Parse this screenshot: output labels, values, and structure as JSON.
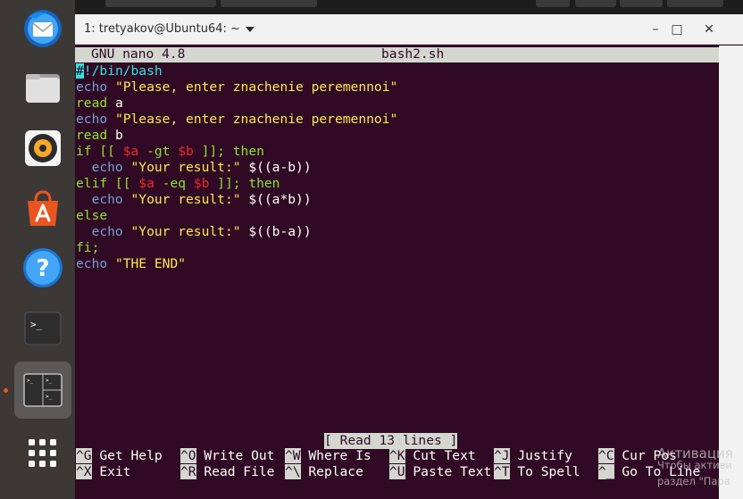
{
  "window": {
    "title": "1: tretyakov@Ubuntu64: ~",
    "minimize_label": "–",
    "maximize_label": "□",
    "close_label": "✕"
  },
  "nano": {
    "version": "GNU nano 4.8",
    "filename": "bash2.sh",
    "status": "[ Read 13 lines ]"
  },
  "code": [
    [
      {
        "t": "#",
        "c": "hash"
      },
      {
        "t": "!/bin/bash",
        "c": "shebang"
      }
    ],
    [
      {
        "t": "echo",
        "c": "kw"
      },
      {
        "t": " ",
        "c": "norm"
      },
      {
        "t": "\"Please, enter znachenie peremennoi\"",
        "c": "str"
      }
    ],
    [
      {
        "t": "read",
        "c": "ctl"
      },
      {
        "t": " a",
        "c": "norm"
      }
    ],
    [
      {
        "t": "echo",
        "c": "kw"
      },
      {
        "t": " ",
        "c": "norm"
      },
      {
        "t": "\"Please, enter znachenie peremennoi\"",
        "c": "str"
      }
    ],
    [
      {
        "t": "read",
        "c": "ctl"
      },
      {
        "t": " b",
        "c": "norm"
      }
    ],
    [
      {
        "t": "if [[ ",
        "c": "ctl"
      },
      {
        "t": "$a",
        "c": "var"
      },
      {
        "t": " -gt ",
        "c": "ctl"
      },
      {
        "t": "$b",
        "c": "var"
      },
      {
        "t": " ]]; then",
        "c": "ctl"
      }
    ],
    [
      {
        "t": "  echo",
        "c": "kw"
      },
      {
        "t": " ",
        "c": "norm"
      },
      {
        "t": "\"Your result:\"",
        "c": "str"
      },
      {
        "t": " $((a-b))",
        "c": "norm"
      }
    ],
    [
      {
        "t": "elif [[ ",
        "c": "ctl"
      },
      {
        "t": "$a",
        "c": "var"
      },
      {
        "t": " -eq ",
        "c": "ctl"
      },
      {
        "t": "$b",
        "c": "var"
      },
      {
        "t": " ]]; then",
        "c": "ctl"
      }
    ],
    [
      {
        "t": "  echo",
        "c": "kw"
      },
      {
        "t": " ",
        "c": "norm"
      },
      {
        "t": "\"Your result:\"",
        "c": "str"
      },
      {
        "t": " $((a*b))",
        "c": "norm"
      }
    ],
    [
      {
        "t": "else",
        "c": "ctl"
      }
    ],
    [
      {
        "t": "  echo",
        "c": "kw"
      },
      {
        "t": " ",
        "c": "norm"
      },
      {
        "t": "\"Your result:\"",
        "c": "str"
      },
      {
        "t": " $((b-a))",
        "c": "norm"
      }
    ],
    [
      {
        "t": "fi;",
        "c": "ctl"
      }
    ],
    [
      {
        "t": "echo",
        "c": "kw"
      },
      {
        "t": " ",
        "c": "norm"
      },
      {
        "t": "\"THE END\"",
        "c": "str"
      }
    ]
  ],
  "shortcuts_row1": [
    {
      "key": "^G",
      "label": "Get Help"
    },
    {
      "key": "^O",
      "label": "Write Out"
    },
    {
      "key": "^W",
      "label": "Where Is"
    },
    {
      "key": "^K",
      "label": "Cut Text"
    },
    {
      "key": "^J",
      "label": "Justify"
    },
    {
      "key": "^C",
      "label": "Cur Pos"
    }
  ],
  "shortcuts_row2": [
    {
      "key": "^X",
      "label": "Exit"
    },
    {
      "key": "^R",
      "label": "Read File"
    },
    {
      "key": "^\\",
      "label": "Replace"
    },
    {
      "key": "^U",
      "label": "Paste Text"
    },
    {
      "key": "^T",
      "label": "To Spell"
    },
    {
      "key": "^_",
      "label": "Go To Line"
    }
  ],
  "dock": [
    {
      "name": "thunderbird-icon"
    },
    {
      "name": "files-icon"
    },
    {
      "name": "rhythmbox-icon"
    },
    {
      "name": "software-center-icon"
    },
    {
      "name": "help-icon"
    },
    {
      "name": "terminal-icon"
    },
    {
      "name": "terminal-active-icon",
      "active": true
    },
    {
      "name": "show-apps-icon"
    }
  ],
  "watermark": {
    "line1": "Активация",
    "line2": "Чтобы активи",
    "line3": "раздел \"Пара"
  },
  "colors": {
    "terminal_bg": "#300a24",
    "keyword": "#729fcf",
    "string": "#fce94f",
    "control": "#8ae234",
    "variable": "#ef2929",
    "accent": "#e95420"
  }
}
